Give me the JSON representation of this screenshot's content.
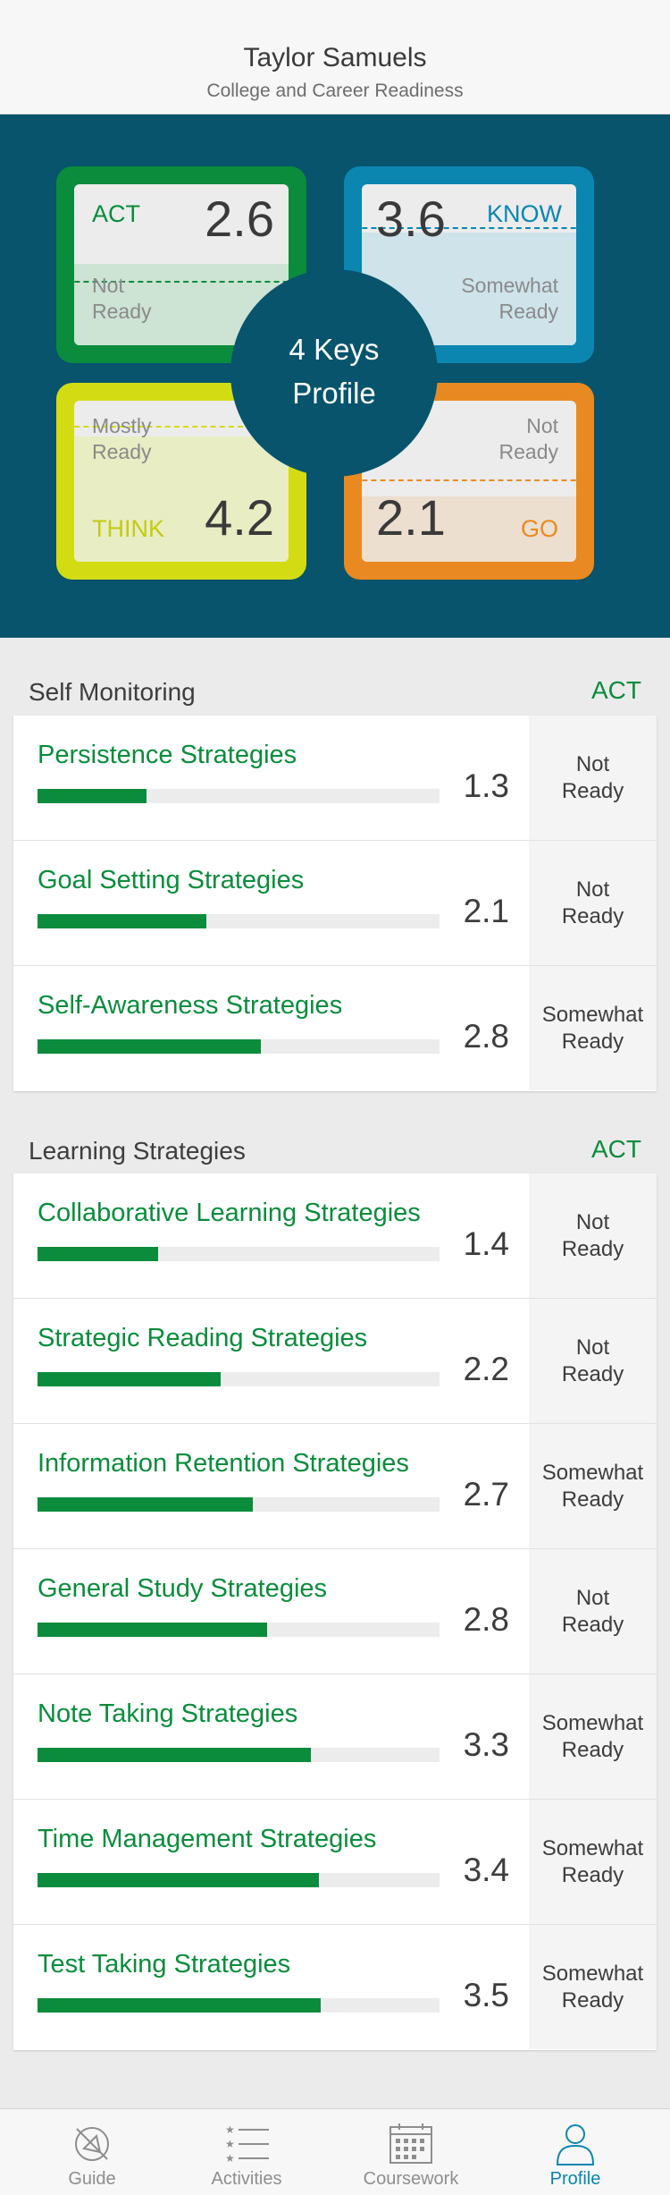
{
  "header": {
    "name": "Taylor Samuels",
    "subtitle": "College and Career Readiness"
  },
  "keys": {
    "center_line1": "4 Keys",
    "center_line2": "Profile",
    "act": {
      "title": "ACT",
      "score": "2.6",
      "status_line1": "Not",
      "status_line2": "Ready",
      "fill": 0.65,
      "color": "#0a8c3c"
    },
    "know": {
      "title": "KNOW",
      "score": "3.6",
      "status_line1": "Somewhat",
      "status_line2": "Ready",
      "fill": 0.9,
      "color": "#0a86b1"
    },
    "think": {
      "title": "THINK",
      "score": "4.2",
      "status_line1": "Mostly",
      "status_line2": "Ready",
      "fill": 1.05,
      "color": "#d3dc13"
    },
    "go": {
      "title": "GO",
      "score": "2.1",
      "status_line1": "Not",
      "status_line2": "Ready",
      "fill": 0.52,
      "color": "#e88a21"
    }
  },
  "self_monitoring": {
    "title": "Self Monitoring",
    "key": "ACT",
    "rows": [
      {
        "label": "Persistence Strategies",
        "value": "1.3",
        "status_line1": "Not",
        "status_line2": "Ready",
        "pct": 0.27
      },
      {
        "label": "Goal Setting Strategies",
        "value": "2.1",
        "status_line1": "Not",
        "status_line2": "Ready",
        "pct": 0.42
      },
      {
        "label": "Self-Awareness Strategies",
        "value": "2.8",
        "status_line1": "Somewhat",
        "status_line2": "Ready",
        "pct": 0.555
      }
    ]
  },
  "learning_strategies": {
    "title": "Learning Strategies",
    "key": "ACT",
    "rows": [
      {
        "label": "Collaborative Learning Strategies",
        "value": "1.4",
        "status_line1": "Not",
        "status_line2": "Ready",
        "pct": 0.3
      },
      {
        "label": "Strategic Reading Strategies",
        "value": "2.2",
        "status_line1": "Not",
        "status_line2": "Ready",
        "pct": 0.455
      },
      {
        "label": "Information Retention Strategies",
        "value": "2.7",
        "status_line1": "Somewhat",
        "status_line2": "Ready",
        "pct": 0.535
      },
      {
        "label": "General Study Strategies",
        "value": "2.8",
        "status_line1": "Not",
        "status_line2": "Ready",
        "pct": 0.57
      },
      {
        "label": "Note Taking Strategies",
        "value": "3.3",
        "status_line1": "Somewhat",
        "status_line2": "Ready",
        "pct": 0.68
      },
      {
        "label": "Time Management Strategies",
        "value": "3.4",
        "status_line1": "Somewhat",
        "status_line2": "Ready",
        "pct": 0.7
      },
      {
        "label": "Test Taking Strategies",
        "value": "3.5",
        "status_line1": "Somewhat",
        "status_line2": "Ready",
        "pct": 0.705
      }
    ]
  },
  "tabs": [
    {
      "label": "Guide",
      "icon": "compass-icon"
    },
    {
      "label": "Activities",
      "icon": "list-icon"
    },
    {
      "label": "Coursework",
      "icon": "calendar-icon"
    },
    {
      "label": "Profile",
      "icon": "person-icon",
      "active": true
    }
  ]
}
